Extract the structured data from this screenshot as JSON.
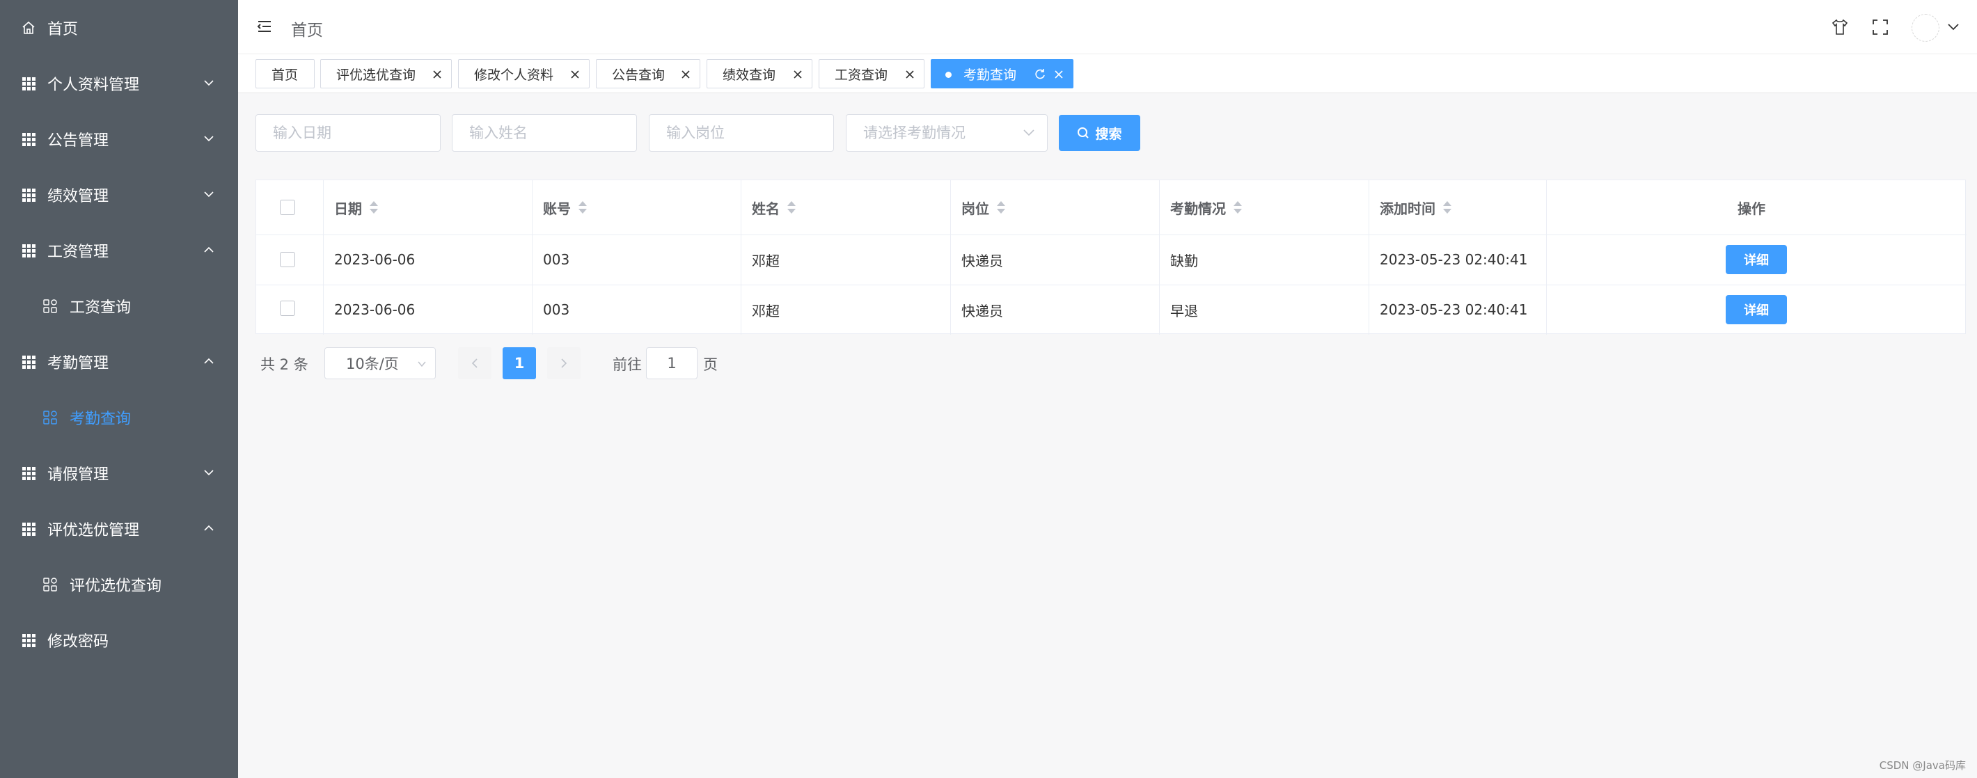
{
  "sidebar": {
    "items": [
      {
        "label": "首页",
        "icon": "home-icon"
      },
      {
        "label": "个人资料管理",
        "icon": "grid-icon",
        "chevron": "down"
      },
      {
        "label": "公告管理",
        "icon": "grid-icon",
        "chevron": "down"
      },
      {
        "label": "绩效管理",
        "icon": "grid-icon",
        "chevron": "down"
      },
      {
        "label": "工资管理",
        "icon": "grid-icon",
        "chevron": "up"
      },
      {
        "label": "工资查询",
        "icon": "apps-icon",
        "sub": true
      },
      {
        "label": "考勤管理",
        "icon": "grid-icon",
        "chevron": "up"
      },
      {
        "label": "考勤查询",
        "icon": "apps-icon",
        "sub": true,
        "active": true
      },
      {
        "label": "请假管理",
        "icon": "grid-icon",
        "chevron": "down"
      },
      {
        "label": "评优选优管理",
        "icon": "grid-icon",
        "chevron": "up"
      },
      {
        "label": "评优选优查询",
        "icon": "apps-icon",
        "sub": true
      },
      {
        "label": "修改密码",
        "icon": "grid-icon"
      }
    ],
    "background": "#545c64",
    "active_color": "#409eff"
  },
  "header": {
    "breadcrumb": "首页"
  },
  "tags": [
    {
      "label": "首页",
      "closable": false
    },
    {
      "label": "评优选优查询",
      "closable": true
    },
    {
      "label": "修改个人资料",
      "closable": true
    },
    {
      "label": "公告查询",
      "closable": true
    },
    {
      "label": "绩效查询",
      "closable": true
    },
    {
      "label": "工资查询",
      "closable": true
    },
    {
      "label": "考勤查询",
      "closable": true,
      "active": true
    }
  ],
  "search": {
    "date_placeholder": "输入日期",
    "name_placeholder": "输入姓名",
    "post_placeholder": "输入岗位",
    "status_placeholder": "请选择考勤情况",
    "button_label": "搜索"
  },
  "table": {
    "headers": [
      "日期",
      "账号",
      "姓名",
      "岗位",
      "考勤情况",
      "添加时间",
      "操作"
    ],
    "rows": [
      {
        "date": "2023-06-06",
        "account": "003",
        "name": "邓超",
        "post": "快递员",
        "status": "缺勤",
        "added": "2023-05-23 02:40:41",
        "action": "详细"
      },
      {
        "date": "2023-06-06",
        "account": "003",
        "name": "邓超",
        "post": "快递员",
        "status": "早退",
        "added": "2023-05-23 02:40:41",
        "action": "详细"
      }
    ]
  },
  "pagination": {
    "total": "共 2 条",
    "page_size": "10条/页",
    "current_page": "1",
    "goto_label": "前往",
    "goto_value": "1",
    "page_suffix": "页"
  },
  "watermark": "CSDN @Java码库",
  "colors": {
    "primary": "#409eff",
    "sidebar": "#545c64"
  }
}
